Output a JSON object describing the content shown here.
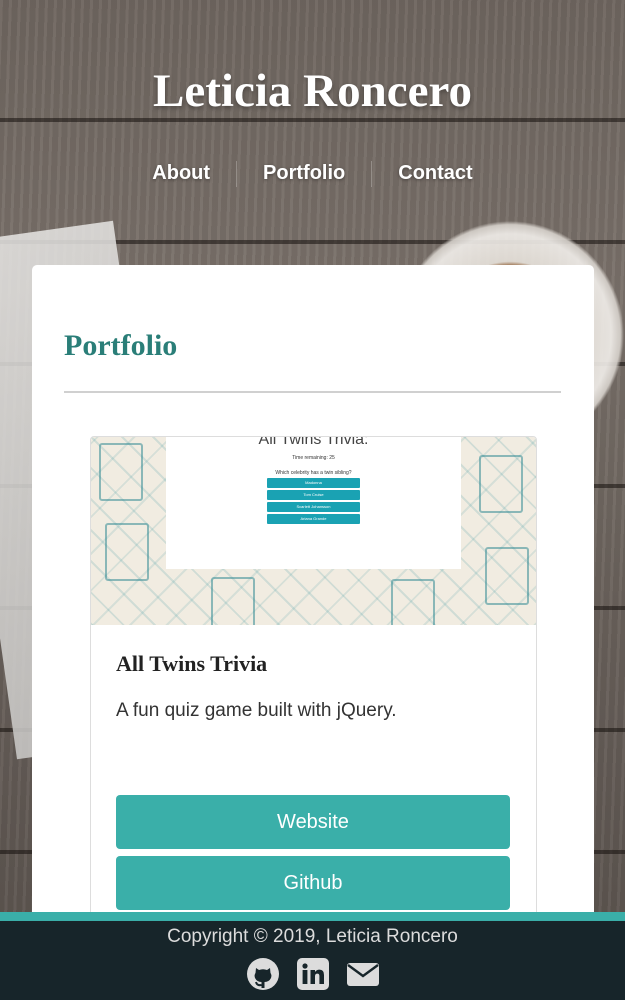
{
  "header": {
    "name": "Leticia Roncero",
    "nav": [
      "About",
      "Portfolio",
      "Contact"
    ]
  },
  "portfolio": {
    "heading": "Portfolio",
    "project": {
      "title": "All Twins Trivia",
      "description": "A fun quiz game built with jQuery.",
      "website_label": "Website",
      "github_label": "Github",
      "thumbnail": {
        "title": "All Twins Trivia:",
        "time": "Time remaining: 25",
        "question": "Which celebrity has a twin sibling?",
        "options": [
          "Madonna",
          "Tom Cruise",
          "Scarlett Johansson",
          "Ariana Grande"
        ]
      }
    }
  },
  "footer": {
    "copyright": "Copyright © 2019, Leticia Roncero",
    "icons": [
      "github-icon",
      "linkedin-icon",
      "envelope-icon"
    ]
  },
  "colors": {
    "accent": "#3aafa9",
    "heading": "#2a7e78",
    "footer_bg": "#17252a"
  }
}
